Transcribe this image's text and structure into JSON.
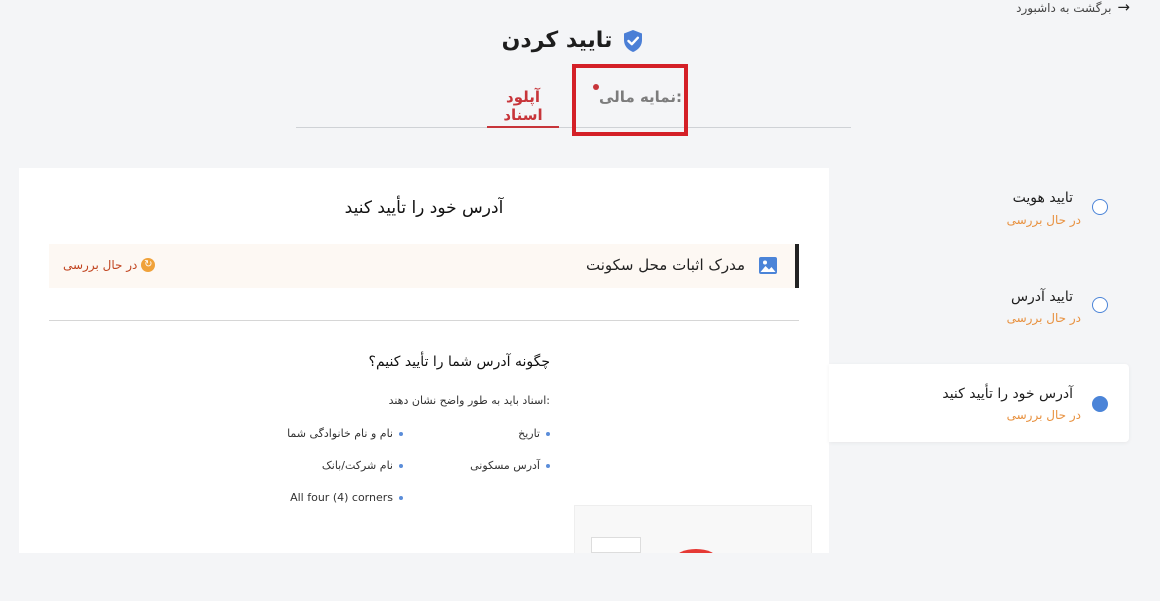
{
  "nav": {
    "back_label": "برگشت به داشبورد"
  },
  "header": {
    "title": "تایید کردن"
  },
  "tabs": [
    {
      "label": "آپلود اسناد"
    },
    {
      "label": "نمایه مالی:"
    }
  ],
  "card": {
    "title": "آدرس خود را تأیید کنید",
    "document": {
      "name": "مدرک اثبات محل سکونت",
      "status": "در حال بررسی"
    },
    "how_title": "چگونه آدرس شما را تأیید کنیم؟",
    "must_show": "اسناد باید به طور واضح نشان دهند:",
    "requirements": [
      "تاریخ",
      "نام و نام خانوادگی شما",
      "آدرس مسکونی",
      "نام شرکت/بانک",
      "All four (4) corners"
    ]
  },
  "steps": [
    {
      "label": "تایید هویت",
      "status": "در حال بررسی"
    },
    {
      "label": "تایید آدرس",
      "status": "در حال بررسی"
    },
    {
      "label": "آدرس خود را تأیید کنید",
      "status": "در حال بررسی"
    }
  ],
  "colors": {
    "accent_red": "#c7353a",
    "status_orange": "#e8913f",
    "step_blue": "#4b84d8",
    "highlight": "#d42027"
  }
}
